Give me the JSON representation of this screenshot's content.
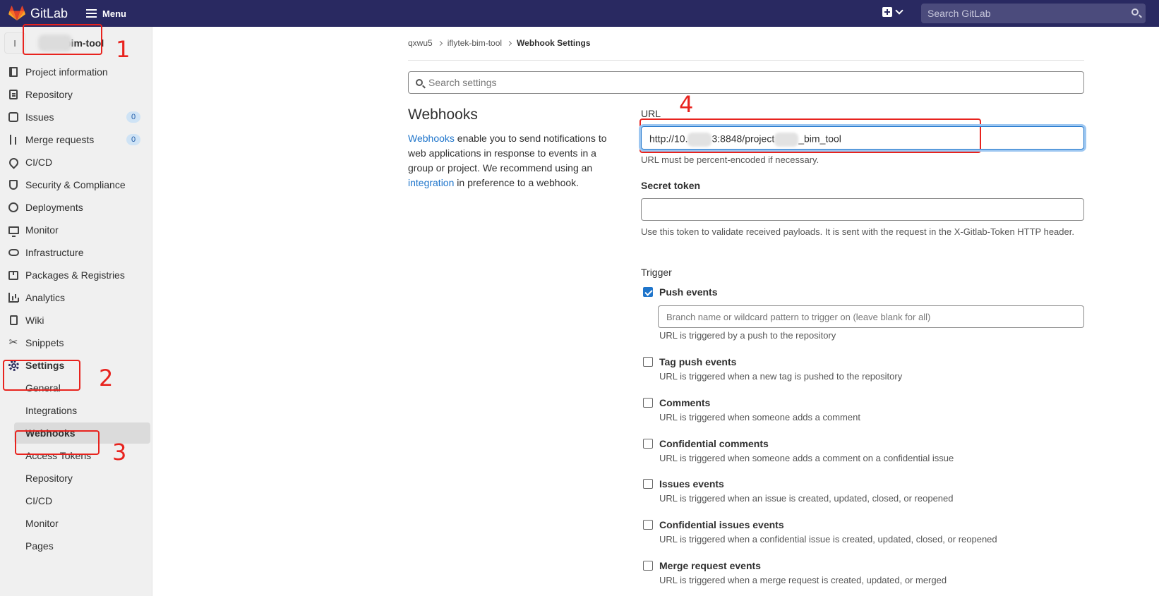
{
  "topbar": {
    "brand": "GitLab",
    "menu_label": "Menu",
    "search_placeholder": "Search GitLab"
  },
  "sidebar": {
    "project_initial": "I",
    "project_name": "bim-tool",
    "items": [
      {
        "label": "Project information",
        "icon": "book-icon"
      },
      {
        "label": "Repository",
        "icon": "document-icon"
      },
      {
        "label": "Issues",
        "icon": "issues-icon",
        "badge": "0"
      },
      {
        "label": "Merge requests",
        "icon": "merge-request-icon",
        "badge": "0"
      },
      {
        "label": "CI/CD",
        "icon": "rocket-icon"
      },
      {
        "label": "Security & Compliance",
        "icon": "shield-icon"
      },
      {
        "label": "Deployments",
        "icon": "deployments-icon"
      },
      {
        "label": "Monitor",
        "icon": "monitor-icon"
      },
      {
        "label": "Infrastructure",
        "icon": "cloud-icon"
      },
      {
        "label": "Packages & Registries",
        "icon": "package-icon"
      },
      {
        "label": "Analytics",
        "icon": "chart-icon"
      },
      {
        "label": "Wiki",
        "icon": "wiki-icon"
      },
      {
        "label": "Snippets",
        "icon": "scissors-icon"
      },
      {
        "label": "Settings",
        "icon": "gear-icon"
      }
    ],
    "settings_sub": [
      "General",
      "Integrations",
      "Webhooks",
      "Access Tokens",
      "Repository",
      "CI/CD",
      "Monitor",
      "Pages"
    ]
  },
  "annotations": [
    "1",
    "2",
    "3",
    "4"
  ],
  "breadcrumb": [
    "qxwu5",
    "iflytek-bim-tool",
    "Webhook Settings"
  ],
  "settings_search_placeholder": "Search settings",
  "webhooks": {
    "title": "Webhooks",
    "desc_link1": "Webhooks",
    "desc_part1": " enable you to send notifications to web applications in response to events in a group or project. We recommend using an ",
    "desc_link2": "integration",
    "desc_part2": " in preference to a webhook."
  },
  "form": {
    "url_label": "URL",
    "url_part1": "http://10.",
    "url_part2": "3:8848/project",
    "url_part3": "_bim_tool",
    "url_help": "URL must be percent-encoded if necessary.",
    "token_label": "Secret token",
    "token_help": "Use this token to validate received payloads. It is sent with the request in the X-Gitlab-Token HTTP header.",
    "trigger_label": "Trigger",
    "branch_placeholder": "Branch name or wildcard pattern to trigger on (leave blank for all)",
    "triggers": [
      {
        "label": "Push events",
        "help": "URL is triggered by a push to the repository",
        "checked": true
      },
      {
        "label": "Tag push events",
        "help": "URL is triggered when a new tag is pushed to the repository",
        "checked": false
      },
      {
        "label": "Comments",
        "help": "URL is triggered when someone adds a comment",
        "checked": false
      },
      {
        "label": "Confidential comments",
        "help": "URL is triggered when someone adds a comment on a confidential issue",
        "checked": false
      },
      {
        "label": "Issues events",
        "help": "URL is triggered when an issue is created, updated, closed, or reopened",
        "checked": false
      },
      {
        "label": "Confidential issues events",
        "help": "URL is triggered when a confidential issue is created, updated, closed, or reopened",
        "checked": false
      },
      {
        "label": "Merge request events",
        "help": "URL is triggered when a merge request is created, updated, or merged",
        "checked": false
      }
    ]
  },
  "colors": {
    "topbar": "#292961",
    "annotation": "#e8231e",
    "link": "#1f75cb"
  }
}
